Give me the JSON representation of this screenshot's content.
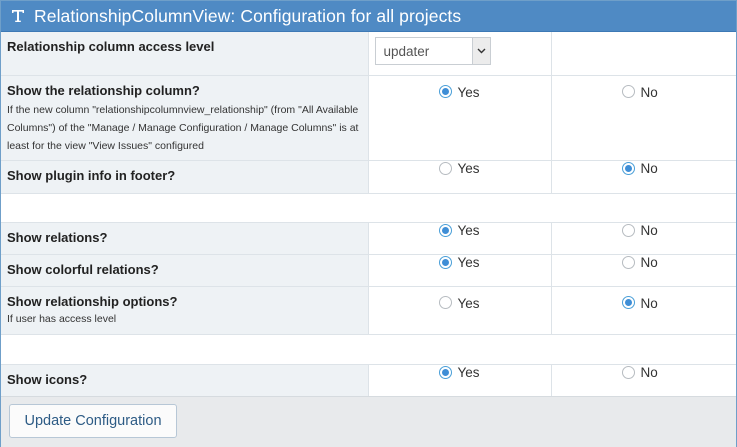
{
  "header": {
    "title": "RelationshipColumnView: Configuration for all projects",
    "icon": "text-icon"
  },
  "rows": [
    {
      "label": "Relationship column access level",
      "type": "select",
      "select_value": "updater"
    },
    {
      "label": "Show the relationship column?",
      "description": "If the new column \"relationshipcolumnview_relationship\" (from \"All Available Columns\") of the \"Manage / Manage Configuration / Manage Columns\" is at least for the view \"View Issues\" configured",
      "yes_label": "Yes",
      "no_label": "No",
      "selected": "yes"
    },
    {
      "label": "Show plugin info in footer?",
      "yes_label": "Yes",
      "no_label": "No",
      "selected": "no"
    },
    {
      "label": "Show relations?",
      "yes_label": "Yes",
      "no_label": "No",
      "selected": "yes"
    },
    {
      "label": "Show colorful relations?",
      "yes_label": "Yes",
      "no_label": "No",
      "selected": "yes"
    },
    {
      "label": "Show relationship options?",
      "description": "If user has access level",
      "yes_label": "Yes",
      "no_label": "No",
      "selected": "no"
    },
    {
      "label": "Show icons?",
      "yes_label": "Yes",
      "no_label": "No",
      "selected": "yes"
    }
  ],
  "footer": {
    "update_button": "Update Configuration"
  },
  "colors": {
    "header_bg": "#4f8ac4",
    "label_bg": "#eef2f5",
    "radio_checked": "#3f8ed6"
  }
}
